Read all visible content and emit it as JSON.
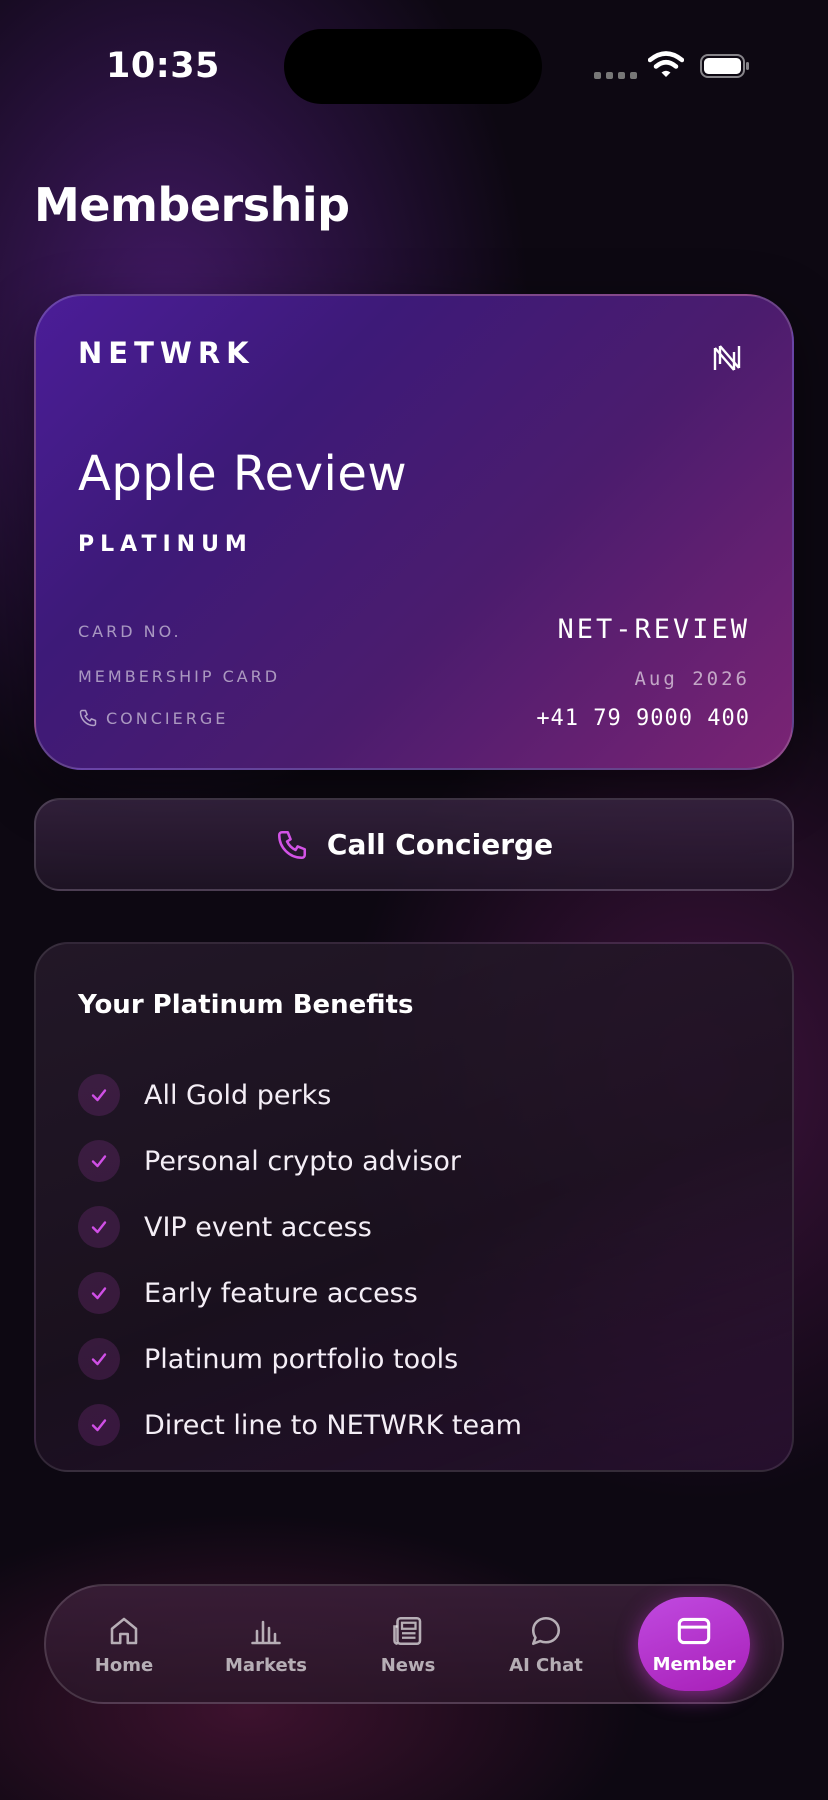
{
  "status_bar": {
    "time": "10:35"
  },
  "page": {
    "title": "Membership"
  },
  "card": {
    "brand": "NETWRK",
    "holder_name": "Apple Review",
    "tier": "PLATINUM",
    "card_no_label": "CARD NO.",
    "card_no_value": "NET-REVIEW",
    "membership_label": "MEMBERSHIP CARD",
    "membership_value": "Aug 2026",
    "concierge_label": "CONCIERGE",
    "concierge_value": "+41 79 9000 400"
  },
  "call_button": {
    "label": "Call Concierge"
  },
  "benefits": {
    "title": "Your Platinum Benefits",
    "items": [
      "All Gold perks",
      "Personal crypto advisor",
      "VIP event access",
      "Early feature access",
      "Platinum portfolio tools",
      "Direct line to NETWRK team"
    ]
  },
  "tabbar": {
    "home": "Home",
    "markets": "Markets",
    "news": "News",
    "ai_chat": "AI Chat",
    "member": "Member"
  },
  "colors": {
    "accent": "#c04ae0",
    "card_start": "#4b1d98",
    "card_end": "#7b2474",
    "background": "#0d0812"
  }
}
